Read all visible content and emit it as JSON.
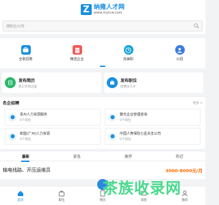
{
  "header": {
    "logo_mark": "Z",
    "site_name": "纳雍人才网",
    "site_url": "www.lnyrcw.com"
  },
  "search": {
    "placeholder": "搜职位/公司"
  },
  "nav": {
    "items": [
      {
        "label": "全职招聘",
        "icon": "briefcase-icon",
        "color": "#1a8fe0"
      },
      {
        "label": "精选企业",
        "icon": "building-icon",
        "color": "#f25a5a"
      },
      {
        "label": "找兼职",
        "icon": "clock-icon",
        "color": "#1aa3d8"
      },
      {
        "label": "公招",
        "icon": "person-icon",
        "color": "#3b7be0"
      }
    ]
  },
  "cards": [
    {
      "title": "发布简历",
      "sub": "找工作到这里",
      "icon": "resume-icon",
      "color": "#2ab86a"
    },
    {
      "title": "发布职位",
      "sub": "招聘员人才",
      "icon": "post-icon",
      "color": "#1a8fe0"
    }
  ],
  "famous": {
    "title": "名企招聘",
    "more": "更多 >",
    "companies": [
      {
        "name": "贵州人力资源服务",
        "count": "0个岗位"
      },
      {
        "name": "雅光企业管理咨询",
        "count": "0个岗位"
      },
      {
        "name": "和盟(广州)人力资源",
        "count": "0个岗位"
      },
      {
        "name": "中国人寿保险七星关支公司",
        "count": "0个岗位"
      }
    ]
  },
  "tabs": [
    "最新",
    "紧急",
    "推荐",
    "附近"
  ],
  "job": {
    "title": "输电线路、开压运维员",
    "salary": "3000-8000元/月"
  },
  "bottom": [
    {
      "label": "首页",
      "icon": "home-icon"
    },
    {
      "label": "职位",
      "icon": "bag-icon"
    },
    {
      "label": "简历",
      "icon": "doc-icon"
    },
    {
      "label": "消息",
      "icon": "message-icon"
    },
    {
      "label": "我的",
      "icon": "user-icon"
    }
  ],
  "watermark": "茶族收录网",
  "colors": {
    "brand": "#1a8fe0",
    "salary": "#ff6a00"
  }
}
